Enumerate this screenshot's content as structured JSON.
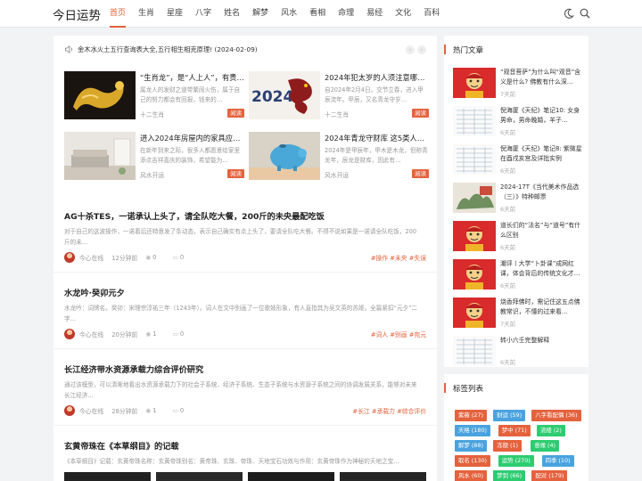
{
  "header": {
    "logo": "今日运势",
    "nav": [
      "首页",
      "生肖",
      "星座",
      "八字",
      "姓名",
      "解梦",
      "风水",
      "看相",
      "命理",
      "易经",
      "文化",
      "百科"
    ],
    "active_index": 0,
    "accent": "#e4623d"
  },
  "notice": {
    "text": "金木水火土五行查询表大全,五行相生相克原理! (2024-02-09)",
    "prev": "‹",
    "next": "›"
  },
  "featured": [
    {
      "title": "“生肖龙”，是“人上人”，有贵…",
      "summary": "属龙人的发财之道带繁闹火伤，属于自己的努力都会有回报，钱来的…",
      "author": "十二生肖",
      "tag": "阅读"
    },
    {
      "title": "2024年犯太岁的人须注意哪…",
      "summary": "自2024年2月4日，交节立春，进入甲辰流年。甲辰，又名青龙守岁…",
      "author": "十二生肖",
      "tag": "阅读"
    },
    {
      "title": "进入2024年房屋内的家具应…",
      "summary": "在新年到来之际，很多人都愿意给家里添点吉祥喜庆的装饰，希望能为…",
      "author": "风水开运",
      "tag": "阅读"
    },
    {
      "title": "2024年青龙守财库 这5类人将…",
      "summary": "2024年是甲辰年，甲木是木龙，但称青龙年，辰龙是财库，因此有…",
      "author": "风水开运",
      "tag": "阅读"
    }
  ],
  "articles": [
    {
      "title": "AG十杀TES，一诺承认上头了，请全队吃大餐，200斤的未央最配吃饭",
      "desc": "对于自己的这波操作，一诺着后还特意发了条动态，表示自己确实有点上头了，要请全队吃大餐。不得不说如果是一诺请全队吃饭，200斤的未…",
      "author": "今心在线",
      "time": "12分钟前",
      "views": "0",
      "comments": "0",
      "tags": "#操作 #未央 #失误"
    },
    {
      "title": "水龙吟·癸卯元夕",
      "desc": "水龙吟：词牌名。癸卯：宋理宗淳祐三年（1243年）。词人在文中别画了一位歌妓形象，有人直指其为吴文英的苏姬。全篇紧扣“元夕”二字…",
      "author": "今心在线",
      "time": "20分钟前",
      "views": "1",
      "comments": "0",
      "tags": "#词人 #别画 #宛元"
    },
    {
      "title": "长江经济带水资源承载力综合评价研究",
      "desc": "通过该模型，可以清晰地看出水资源承载力下的社会子系统、经济子系统、生态子系统与水资源子系统之间的协调发展关系，能够对未来长江经济…",
      "author": "今心在线",
      "time": "28分钟前",
      "views": "1",
      "comments": "0",
      "tags": "#长江 #承载力 #综合评价"
    },
    {
      "title": "玄黄帝珠在《本草纲目》的记载",
      "desc": "《本草纲目》记载：玄黄帝珠名称：玄黄帝珠别名：黄帝珠、玄珠、帝珠、天地宝石功效与作用：玄黄帝珠作为神秘的天地之宝…",
      "author": "",
      "time": "",
      "views": "",
      "comments": "",
      "tags": ""
    }
  ],
  "sidebar": {
    "hot_title": "热门文章",
    "hot": [
      {
        "title": "“观音菩萨”为什么叫“观音”含义是什么? 佛教有什么深…",
        "date": "7天前"
      },
      {
        "title": "倪海厦《天纪》笔记10: 女身男命，男命晚婚，羊子…",
        "date": "6天前"
      },
      {
        "title": "倪海厦《天纪》笔记8: 紫微星在酉戌亥宫及详批实例",
        "date": "6天前"
      },
      {
        "title": "2024-17T《当代美术作品选（三）》特种邮票",
        "date": "6天前"
      },
      {
        "title": "道长们的“法名”与“道号”有什么区别",
        "date": "6天前"
      },
      {
        "title": "潮评丨大学“卜卦课”成网红课，体会背后的传统文化才…",
        "date": "6天前"
      },
      {
        "title": "烧香拜佛时，需记住这五点佛教常识，不懂的过来看…",
        "date": "7天前"
      },
      {
        "title": "转小六壬完整解释",
        "date": "6天前"
      }
    ],
    "tags_title": "标签列表",
    "tags": [
      {
        "label": "紫薇 (27)",
        "color": "#e4623d"
      },
      {
        "label": "财运 (59)",
        "color": "#4aa3df"
      },
      {
        "label": "八字看配偶 (36)",
        "color": "#e4623d"
      },
      {
        "label": "天格 (180)",
        "color": "#4aa3df"
      },
      {
        "label": "梦中 (71)",
        "color": "#e4623d"
      },
      {
        "label": "流楼 (2)",
        "color": "#2ecc71"
      },
      {
        "label": "解梦 (88)",
        "color": "#4aa3df"
      },
      {
        "label": "冻额 (1)",
        "color": "#e4623d"
      },
      {
        "label": "意缘 (4)",
        "color": "#2ecc71"
      },
      {
        "label": "取名 (130)",
        "color": "#e4623d"
      },
      {
        "label": "运势 (270)",
        "color": "#2ecc71"
      },
      {
        "label": "四季 (10)",
        "color": "#4aa3df"
      },
      {
        "label": "风水 (60)",
        "color": "#e4623d"
      },
      {
        "label": "梦到 (66)",
        "color": "#2ecc71"
      },
      {
        "label": "配对 (179)",
        "color": "#e4623d"
      }
    ]
  }
}
